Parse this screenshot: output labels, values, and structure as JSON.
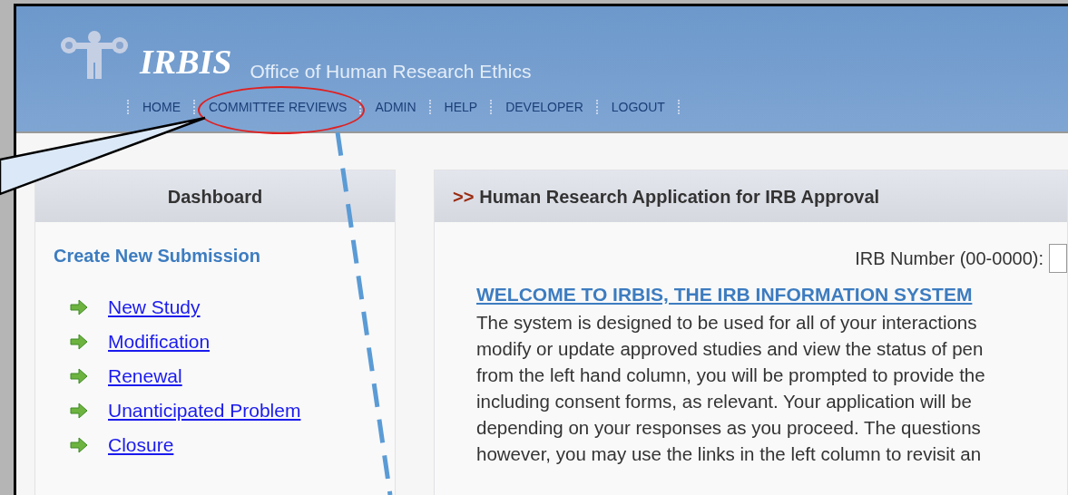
{
  "header": {
    "logo": "IRBIS",
    "subtitle": "Office of Human Research Ethics"
  },
  "nav": [
    {
      "label": "HOME",
      "circled": false
    },
    {
      "label": "COMMITTEE REVIEWS",
      "circled": true
    },
    {
      "label": "ADMIN",
      "circled": false
    },
    {
      "label": "HELP",
      "circled": false
    },
    {
      "label": "DEVELOPER",
      "circled": false
    },
    {
      "label": "LOGOUT",
      "circled": false
    }
  ],
  "dashboard": {
    "title": "Dashboard",
    "section": "Create New Submission",
    "links": [
      "New Study",
      "Modification",
      "Renewal",
      "Unanticipated Problem",
      "Closure"
    ]
  },
  "main": {
    "marker": ">>",
    "title": "Human Research Application for IRB Approval",
    "field_label": "IRB Number (00-0000):",
    "heading": "WELCOME TO IRBIS, THE IRB INFORMATION SYSTEM",
    "lines": [
      "The system is designed to be used for all of your interactions",
      "modify or update approved studies and view the status of pen",
      "from the left hand column, you will be prompted to provide the",
      "including consent forms, as relevant. Your application will be",
      "depending on your responses as you proceed. The questions",
      "however, you may use the links in the left column to revisit an"
    ]
  }
}
